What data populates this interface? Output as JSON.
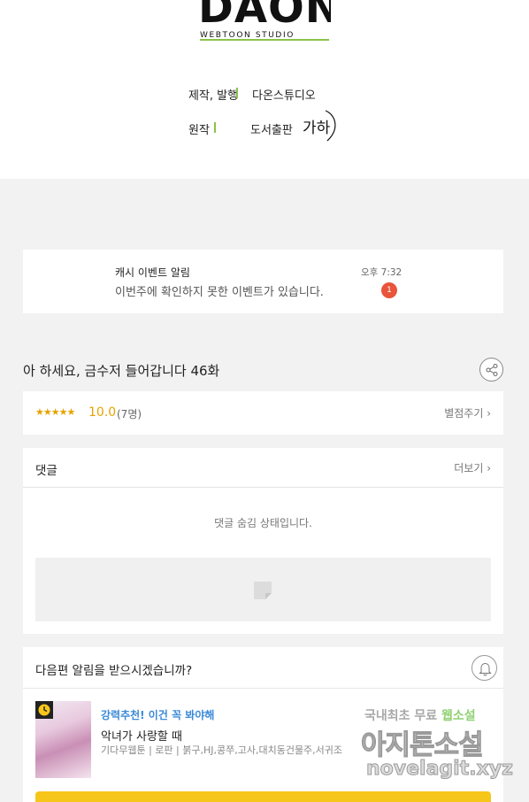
{
  "credits": {
    "logo_main": "DAON",
    "logo_sub": "WEBTOON STUDIO",
    "production_label": "제작, 발행",
    "production_value": "다온스튜디오",
    "original_label": "원작",
    "original_value": "도서출판",
    "publisher_sign": "가하"
  },
  "notification": {
    "title": "캐시 이벤트 알림",
    "text": "이번주에 확인하지 못한 이벤트가 있습니다.",
    "time": "오후 7:32",
    "badge": "1"
  },
  "episode": {
    "title": "아 하세요, 금수저 들어갑니다 46화"
  },
  "rating": {
    "stars": "★★★★★",
    "score": "10.0",
    "count": "(7명)",
    "rate_link": "별점주기 ›"
  },
  "comments": {
    "title": "댓글",
    "more": "더보기 ›",
    "hidden_text": "댓글 숨김 상태입니다."
  },
  "next_episode": {
    "question": "다음편 알림을 받으시겠습니까?",
    "recommend_label": "강력추천! 이건 꼭 봐야해",
    "recommend_title": "악녀가 사랑할 때",
    "recommend_meta": "기다무웹툰 | 로판 | 붉구,HJ,콩쭈,고사,대치동건물주,서귀조"
  },
  "watermark": {
    "line1_a": "국내최초 무료 ",
    "line1_b": "웹소설",
    "line2": "아지톤소설",
    "line3": "novelagit.xyz"
  },
  "colors": {
    "accent_green": "#8bc34a",
    "badge_red": "#e8553a",
    "star_gold": "#e6a300",
    "link_blue": "#3a8ad8",
    "button_yellow": "#f7c61a"
  }
}
